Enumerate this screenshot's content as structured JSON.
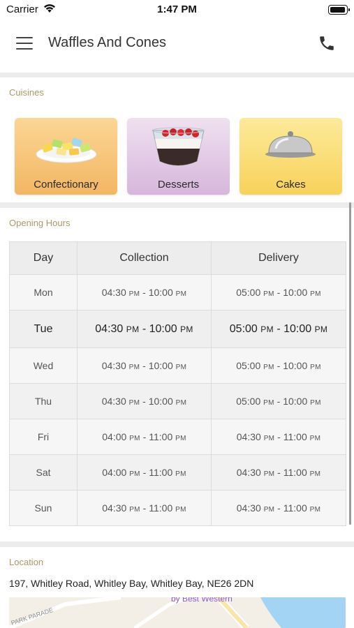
{
  "status_bar": {
    "carrier": "Carrier",
    "time": "1:47 PM"
  },
  "nav": {
    "title": "Waffles And Cones",
    "menu_icon": "hamburger-menu-icon",
    "call_icon": "phone-icon"
  },
  "cuisines": {
    "label": "Cuisines",
    "items": [
      {
        "name": "Confectionary",
        "icon": "candy-plate-image",
        "color": "#f5c06e"
      },
      {
        "name": "Desserts",
        "icon": "dessert-bowl-image",
        "color": "#e2c9e6"
      },
      {
        "name": "Cakes",
        "icon": "cloche-image",
        "color": "#fbe07a"
      }
    ]
  },
  "opening_hours": {
    "label": "Opening Hours",
    "headers": [
      "Day",
      "Collection",
      "Delivery"
    ],
    "rows": [
      {
        "day": "Mon",
        "collection": {
          "open": "04:30",
          "open_ampm": "PM",
          "close": "10:00",
          "close_ampm": "PM"
        },
        "delivery": {
          "open": "05:00",
          "open_ampm": "PM",
          "close": "10:00",
          "close_ampm": "PM"
        }
      },
      {
        "day": "Tue",
        "collection": {
          "open": "04:30",
          "open_ampm": "PM",
          "close": "10:00",
          "close_ampm": "PM"
        },
        "delivery": {
          "open": "05:00",
          "open_ampm": "PM",
          "close": "10:00",
          "close_ampm": "PM"
        }
      },
      {
        "day": "Wed",
        "collection": {
          "open": "04:30",
          "open_ampm": "PM",
          "close": "10:00",
          "close_ampm": "PM"
        },
        "delivery": {
          "open": "05:00",
          "open_ampm": "PM",
          "close": "10:00",
          "close_ampm": "PM"
        }
      },
      {
        "day": "Thu",
        "collection": {
          "open": "04:30",
          "open_ampm": "PM",
          "close": "10:00",
          "close_ampm": "PM"
        },
        "delivery": {
          "open": "05:00",
          "open_ampm": "PM",
          "close": "10:00",
          "close_ampm": "PM"
        }
      },
      {
        "day": "Fri",
        "collection": {
          "open": "04:00",
          "open_ampm": "PM",
          "close": "11:00",
          "close_ampm": "PM"
        },
        "delivery": {
          "open": "04:30",
          "open_ampm": "PM",
          "close": "11:00",
          "close_ampm": "PM"
        }
      },
      {
        "day": "Sat",
        "collection": {
          "open": "04:00",
          "open_ampm": "PM",
          "close": "11:00",
          "close_ampm": "PM"
        },
        "delivery": {
          "open": "04:30",
          "open_ampm": "PM",
          "close": "11:00",
          "close_ampm": "PM"
        }
      },
      {
        "day": "Sun",
        "collection": {
          "open": "04:30",
          "open_ampm": "PM",
          "close": "11:00",
          "close_ampm": "PM"
        },
        "delivery": {
          "open": "04:30",
          "open_ampm": "PM",
          "close": "11:00",
          "close_ampm": "PM"
        }
      }
    ],
    "highlighted_day": "Tue"
  },
  "location": {
    "label": "Location",
    "address": "197, Whitley Road, Whitley Bay, Whitley Bay, NE26 2DN",
    "map_labels": [
      "by Best Western",
      "PARK PARADE"
    ]
  }
}
